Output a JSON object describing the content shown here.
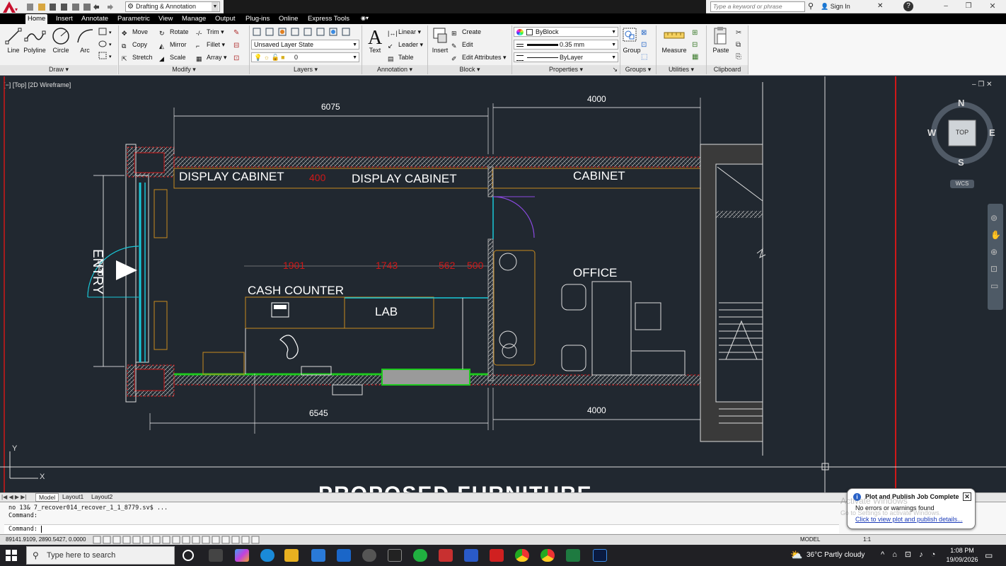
{
  "titlebar": {
    "workspace": "Drafting & Annotation",
    "search_placeholder": "Type a keyword or phrase",
    "sign_in": "Sign In"
  },
  "ribbon_tabs": [
    "Home",
    "Insert",
    "Annotate",
    "Parametric",
    "View",
    "Manage",
    "Output",
    "Plug-ins",
    "Online",
    "Express Tools"
  ],
  "draw_panel": {
    "title": "Draw",
    "line": "Line",
    "polyline": "Polyline",
    "circle": "Circle",
    "arc": "Arc"
  },
  "modify_panel": {
    "title": "Modify",
    "move": "Move",
    "rotate": "Rotate",
    "trim": "Trim",
    "copy": "Copy",
    "mirror": "Mirror",
    "fillet": "Fillet",
    "stretch": "Stretch",
    "scale": "Scale",
    "array": "Array"
  },
  "layers_panel": {
    "title": "Layers",
    "layer_state": "Unsaved Layer State",
    "current_layer": "0"
  },
  "annotation_panel": {
    "title": "Annotation",
    "text": "Text",
    "linear": "Linear",
    "leader": "Leader",
    "table": "Table"
  },
  "block_panel": {
    "title": "Block",
    "insert": "Insert",
    "create": "Create",
    "edit": "Edit",
    "edit_attributes": "Edit Attributes"
  },
  "properties_panel": {
    "title": "Properties",
    "color": "ByBlock",
    "lineweight": "0.35 mm",
    "linetype": "ByLayer"
  },
  "groups_panel": {
    "title": "Groups",
    "group": "Group"
  },
  "utilities_panel": {
    "title": "Utilities",
    "measure": "Measure"
  },
  "clipboard_panel": {
    "title": "Clipboard",
    "paste": "Paste"
  },
  "viewport": {
    "label": "[−] [Top] [2D Wireframe]"
  },
  "viewcube": {
    "n": "N",
    "s": "S",
    "e": "E",
    "w": "W",
    "top": "TOP",
    "wcs": "WCS"
  },
  "drawing": {
    "dim_top_left": "6075",
    "dim_top_right": "4000",
    "dim_bottom_left": "6545",
    "dim_bottom_right": "4000",
    "dim_entry": "3640",
    "red_400": "400",
    "red_1901": "1901",
    "red_1743": "1743",
    "red_562": "562",
    "red_500": "500",
    "display_cabinet_1": "DISPLAY  CABINET",
    "display_cabinet_2": "DISPLAY  CABINET",
    "cabinet": "CABINET",
    "entry": "ENTRY",
    "cash_counter": "CASH COUNTER",
    "lab": "LAB",
    "office": "OFFICE",
    "proposed": "PROPOSED FURNITURE",
    "ucs_x": "X",
    "ucs_y": "Y"
  },
  "layout_tabs": [
    "Model",
    "Layout1",
    "Layout2"
  ],
  "command": {
    "line1": "no 13& 7_recover014_recover_1_1_8779.sv$ ...",
    "line2": "Command:",
    "prompt": "Command:"
  },
  "status": {
    "coords": "89141.9109, 2890.5427, 0.0000",
    "model": "MODEL",
    "scale": "1:1"
  },
  "notification": {
    "title": "Plot and Publish Job Complete",
    "body": "No errors or warnings found",
    "link": "Click to view plot and publish details...",
    "watermark1": "Activate Windows",
    "watermark2": "Go to Settings to activate Windows."
  },
  "taskbar": {
    "search_placeholder": "Type here to search",
    "weather": "36°C  Partly cloudy",
    "time": "1:08 PM",
    "date": "19/09/2026"
  },
  "colors": {
    "canvas": "#212830",
    "wall_red": "#d01818",
    "accent_cyan": "#19c8d8",
    "green": "#1ec81e",
    "orange": "#c88a1e"
  }
}
